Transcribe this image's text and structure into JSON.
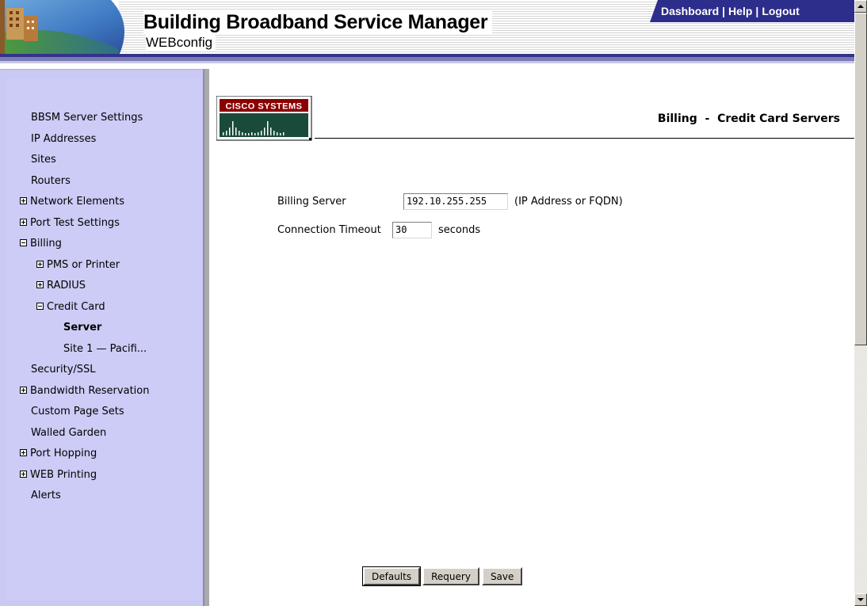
{
  "header": {
    "title": "Building Broadband Service Manager",
    "subtitle": "WEBconfig",
    "links": [
      "Dashboard",
      "Help",
      "Logout"
    ],
    "colors": {
      "nav_bar": "#2d2d8c",
      "sidebar": "#ccccf6",
      "rule": "#33338a"
    }
  },
  "sidebar": {
    "items": [
      {
        "label": "BBSM Server Settings",
        "expander": "none",
        "level": 0
      },
      {
        "label": "IP Addresses",
        "expander": "none",
        "level": 0
      },
      {
        "label": "Sites",
        "expander": "none",
        "level": 0
      },
      {
        "label": "Routers",
        "expander": "none",
        "level": 0
      },
      {
        "label": "Network Elements",
        "expander": "plus",
        "level": 0
      },
      {
        "label": "Port Test Settings",
        "expander": "plus",
        "level": 0
      },
      {
        "label": "Billing",
        "expander": "minus",
        "level": 0
      },
      {
        "label": "PMS or Printer",
        "expander": "plus",
        "level": 1
      },
      {
        "label": "RADIUS",
        "expander": "plus",
        "level": 1
      },
      {
        "label": "Credit Card",
        "expander": "minus",
        "level": 1
      },
      {
        "label": "Server",
        "expander": "none",
        "level": 2,
        "selected": true
      },
      {
        "label": "Site 1 — Pacifi...",
        "expander": "none",
        "level": 2
      },
      {
        "label": "Security/SSL",
        "expander": "none",
        "level": 0
      },
      {
        "label": "Bandwidth Reservation",
        "expander": "plus",
        "level": 0
      },
      {
        "label": "Custom Page Sets",
        "expander": "none",
        "level": 0
      },
      {
        "label": "Walled Garden",
        "expander": "none",
        "level": 0
      },
      {
        "label": "Port Hopping",
        "expander": "plus",
        "level": 0
      },
      {
        "label": "WEB Printing",
        "expander": "plus",
        "level": 0
      },
      {
        "label": "Alerts",
        "expander": "none",
        "level": 0
      }
    ]
  },
  "main": {
    "logo_text": "Cisco Systems",
    "heading": "Billing  -  Credit Card Servers",
    "billing_server": {
      "label": "Billing Server",
      "value": "192.10.255.255",
      "hint": "(IP Address or FQDN)"
    },
    "timeout": {
      "label": "Connection Timeout",
      "value": "30",
      "unit": "seconds"
    },
    "buttons": {
      "defaults": "Defaults",
      "requery": "Requery",
      "save": "Save"
    }
  }
}
